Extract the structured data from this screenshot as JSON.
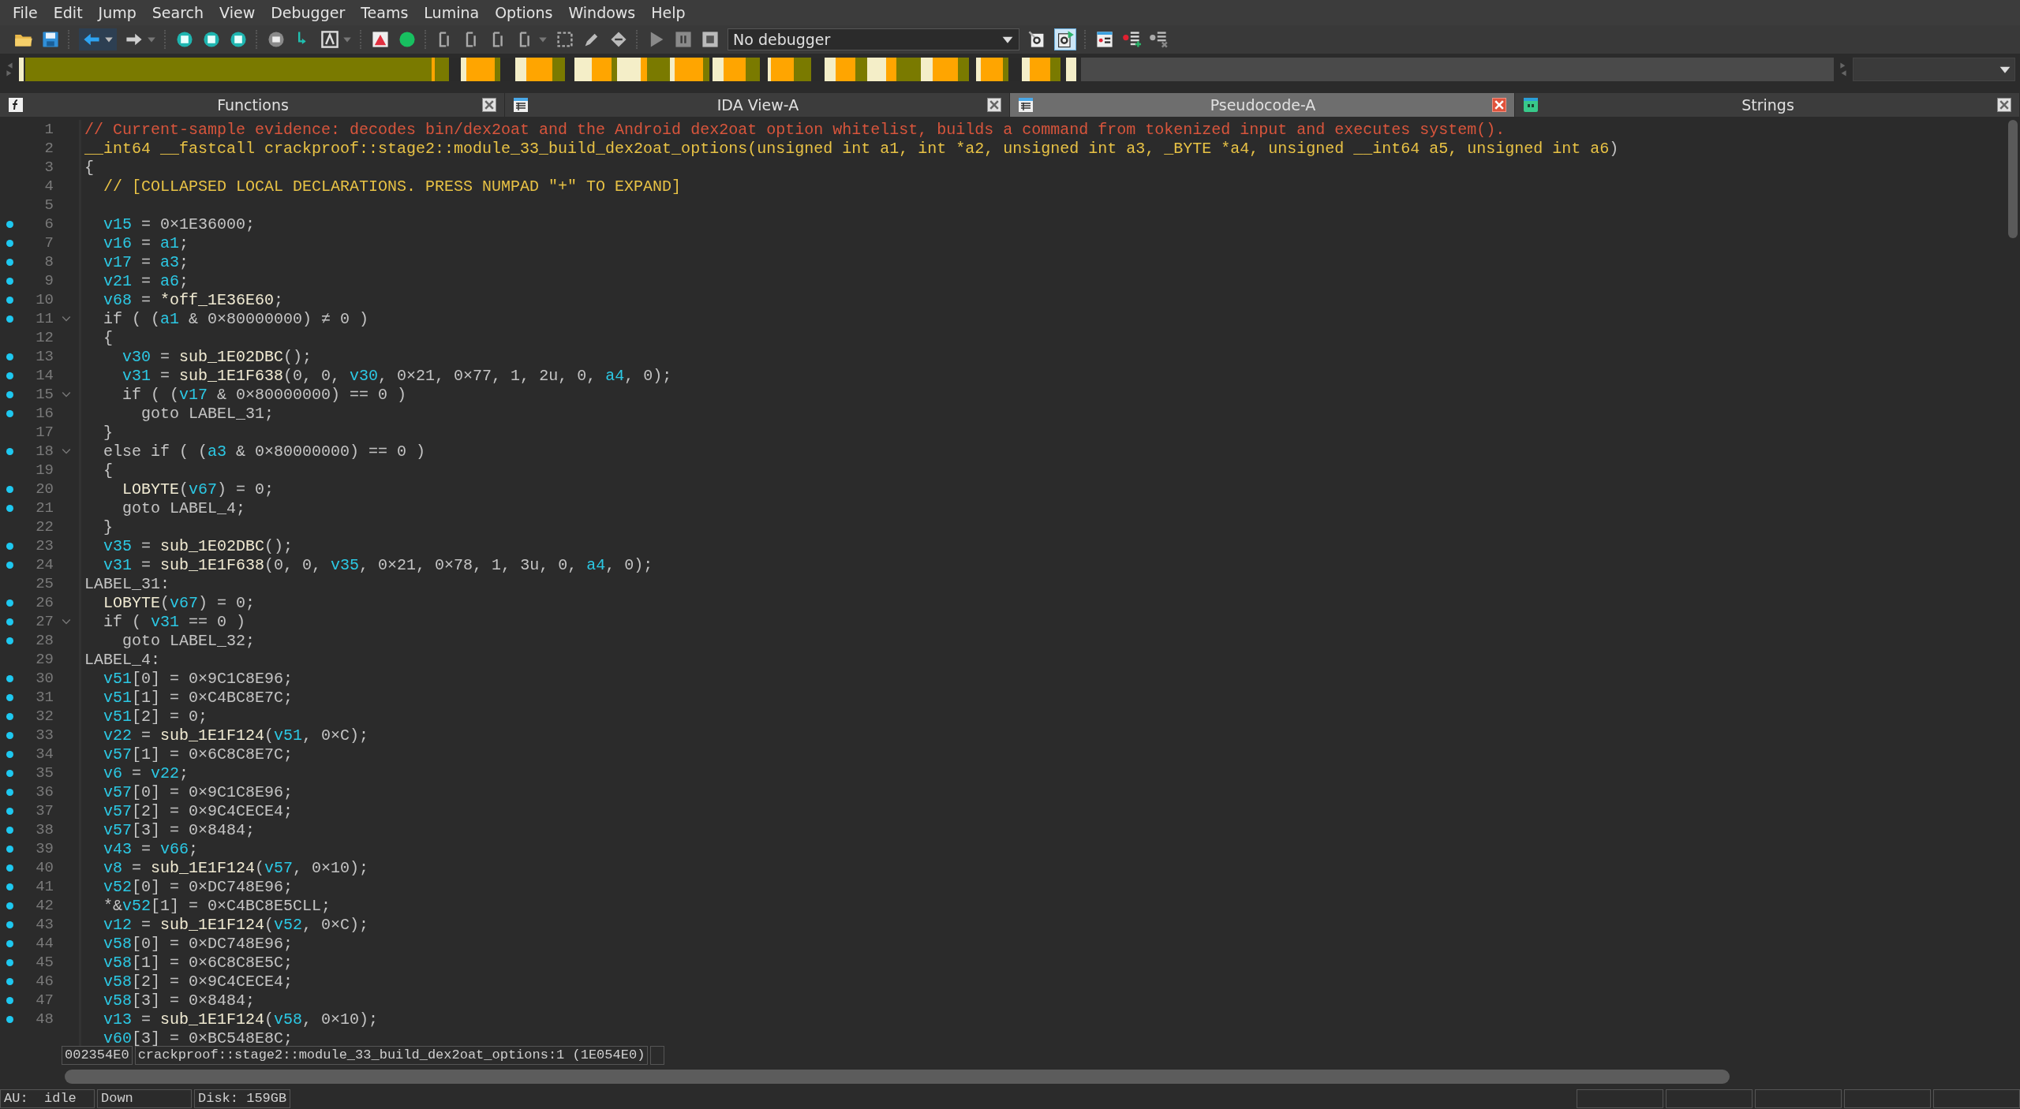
{
  "menu": [
    "File",
    "Edit",
    "Jump",
    "Search",
    "View",
    "Debugger",
    "Teams",
    "Lumina",
    "Options",
    "Windows",
    "Help"
  ],
  "toolbar": {
    "debugger_select": "No debugger"
  },
  "tabs": [
    {
      "label": "Functions",
      "selected": false,
      "kind": "functions"
    },
    {
      "label": "IDA View-A",
      "selected": false,
      "kind": "listing"
    },
    {
      "label": "Pseudocode-A",
      "selected": true,
      "kind": "listing"
    },
    {
      "label": "Strings",
      "selected": false,
      "kind": "strings"
    }
  ],
  "code": {
    "lines": [
      {
        "number": "1",
        "marked": false,
        "fold": false,
        "tokens": [
          {
            "kind": "comment",
            "text": "// Current-sample evidence: decodes bin/dex2oat and the Android dex2oat option whitelist, builds a command from tokenized input and executes system()."
          }
        ]
      },
      {
        "number": "2",
        "marked": false,
        "fold": false,
        "tokens": [
          {
            "kind": "header",
            "text": "__int64 __fastcall crackproof::stage2::module_33_build_dex2oat_options(unsigned int a1, int *a2, unsigned int a3, _BYTE *a4, unsigned __int64 a5, unsigned int a6"
          },
          {
            "kind": "plain",
            "text": ")"
          }
        ]
      },
      {
        "number": "3",
        "marked": false,
        "fold": false,
        "tokens": [
          {
            "kind": "plain",
            "text": "{"
          }
        ]
      },
      {
        "number": "4",
        "marked": false,
        "fold": false,
        "tokens": [
          {
            "kind": "header",
            "text": "  // [COLLAPSED LOCAL DECLARATIONS. PRESS NUMPAD \"+\" TO EXPAND]"
          }
        ]
      },
      {
        "number": "5",
        "marked": false,
        "fold": false
      },
      {
        "number": "6",
        "marked": true,
        "fold": false,
        "tokens": [
          {
            "kind": "var",
            "text": "  v15"
          },
          {
            "kind": "plain",
            "text": " = 0×1E36000;"
          }
        ]
      },
      {
        "number": "7",
        "marked": true,
        "fold": false,
        "tokens": [
          {
            "kind": "var",
            "text": "  v16"
          },
          {
            "kind": "plain",
            "text": " = "
          },
          {
            "kind": "var",
            "text": "a1"
          },
          {
            "kind": "plain",
            "text": ";"
          }
        ]
      },
      {
        "number": "8",
        "marked": true,
        "fold": false,
        "tokens": [
          {
            "kind": "var",
            "text": "  v17"
          },
          {
            "kind": "plain",
            "text": " = "
          },
          {
            "kind": "var",
            "text": "a3"
          },
          {
            "kind": "plain",
            "text": ";"
          }
        ]
      },
      {
        "number": "9",
        "marked": true,
        "fold": false,
        "tokens": [
          {
            "kind": "var",
            "text": "  v21"
          },
          {
            "kind": "plain",
            "text": " = "
          },
          {
            "kind": "var",
            "text": "a6"
          },
          {
            "kind": "plain",
            "text": ";"
          }
        ]
      },
      {
        "number": "10",
        "marked": true,
        "fold": false,
        "tokens": [
          {
            "kind": "var",
            "text": "  v68"
          },
          {
            "kind": "plain",
            "text": " = "
          },
          {
            "kind": "name",
            "text": "*off_1E36E60"
          },
          {
            "kind": "plain",
            "text": ";"
          }
        ]
      },
      {
        "number": "11",
        "marked": true,
        "fold": true,
        "tokens": [
          {
            "kind": "plain",
            "text": "  if ( ("
          },
          {
            "kind": "var",
            "text": "a1"
          },
          {
            "kind": "plain",
            "text": " & 0×80000000) ≠ 0 )"
          }
        ]
      },
      {
        "number": "12",
        "marked": false,
        "fold": false,
        "tokens": [
          {
            "kind": "plain",
            "text": "  {"
          }
        ]
      },
      {
        "number": "13",
        "marked": true,
        "fold": false,
        "tokens": [
          {
            "kind": "var",
            "text": "    v30"
          },
          {
            "kind": "plain",
            "text": " = "
          },
          {
            "kind": "name",
            "text": "sub_1E02DBC"
          },
          {
            "kind": "plain",
            "text": "();"
          }
        ]
      },
      {
        "number": "14",
        "marked": true,
        "fold": false,
        "tokens": [
          {
            "kind": "var",
            "text": "    v31"
          },
          {
            "kind": "plain",
            "text": " = "
          },
          {
            "kind": "name",
            "text": "sub_1E1F638"
          },
          {
            "kind": "plain",
            "text": "(0, 0, "
          },
          {
            "kind": "var",
            "text": "v30"
          },
          {
            "kind": "plain",
            "text": ", 0×21, 0×77, 1, 2u, 0, "
          },
          {
            "kind": "var",
            "text": "a4"
          },
          {
            "kind": "plain",
            "text": ", 0);"
          }
        ]
      },
      {
        "number": "15",
        "marked": true,
        "fold": true,
        "tokens": [
          {
            "kind": "plain",
            "text": "    if ( ("
          },
          {
            "kind": "var",
            "text": "v17"
          },
          {
            "kind": "plain",
            "text": " & 0×80000000) == 0 )"
          }
        ]
      },
      {
        "number": "16",
        "marked": true,
        "fold": false,
        "tokens": [
          {
            "kind": "plain",
            "text": "      goto LABEL_31;"
          }
        ]
      },
      {
        "number": "17",
        "marked": false,
        "fold": false,
        "tokens": [
          {
            "kind": "plain",
            "text": "  }"
          }
        ]
      },
      {
        "number": "18",
        "marked": true,
        "fold": true,
        "tokens": [
          {
            "kind": "plain",
            "text": "  else if ( ("
          },
          {
            "kind": "var",
            "text": "a3"
          },
          {
            "kind": "plain",
            "text": " & 0×80000000) == 0 )"
          }
        ]
      },
      {
        "number": "19",
        "marked": false,
        "fold": false,
        "tokens": [
          {
            "kind": "plain",
            "text": "  {"
          }
        ]
      },
      {
        "number": "20",
        "marked": true,
        "fold": false,
        "tokens": [
          {
            "kind": "name",
            "text": "    LOBYTE"
          },
          {
            "kind": "plain",
            "text": "("
          },
          {
            "kind": "var",
            "text": "v67"
          },
          {
            "kind": "plain",
            "text": ") = 0;"
          }
        ]
      },
      {
        "number": "21",
        "marked": true,
        "fold": false,
        "tokens": [
          {
            "kind": "plain",
            "text": "    goto LABEL_4;"
          }
        ]
      },
      {
        "number": "22",
        "marked": false,
        "fold": false,
        "tokens": [
          {
            "kind": "plain",
            "text": "  }"
          }
        ]
      },
      {
        "number": "23",
        "marked": true,
        "fold": false,
        "tokens": [
          {
            "kind": "var",
            "text": "  v35"
          },
          {
            "kind": "plain",
            "text": " = "
          },
          {
            "kind": "name",
            "text": "sub_1E02DBC"
          },
          {
            "kind": "plain",
            "text": "();"
          }
        ]
      },
      {
        "number": "24",
        "marked": true,
        "fold": false,
        "tokens": [
          {
            "kind": "var",
            "text": "  v31"
          },
          {
            "kind": "plain",
            "text": " = "
          },
          {
            "kind": "name",
            "text": "sub_1E1F638"
          },
          {
            "kind": "plain",
            "text": "(0, 0, "
          },
          {
            "kind": "var",
            "text": "v35"
          },
          {
            "kind": "plain",
            "text": ", 0×21, 0×78, 1, 3u, 0, "
          },
          {
            "kind": "var",
            "text": "a4"
          },
          {
            "kind": "plain",
            "text": ", 0);"
          }
        ]
      },
      {
        "number": "25",
        "marked": false,
        "fold": false,
        "tokens": [
          {
            "kind": "plain",
            "text": "LABEL_31:"
          }
        ]
      },
      {
        "number": "26",
        "marked": true,
        "fold": false,
        "tokens": [
          {
            "kind": "name",
            "text": "  LOBYTE"
          },
          {
            "kind": "plain",
            "text": "("
          },
          {
            "kind": "var",
            "text": "v67"
          },
          {
            "kind": "plain",
            "text": ") = 0;"
          }
        ]
      },
      {
        "number": "27",
        "marked": true,
        "fold": true,
        "tokens": [
          {
            "kind": "plain",
            "text": "  if ( "
          },
          {
            "kind": "var",
            "text": "v31"
          },
          {
            "kind": "plain",
            "text": " == 0 )"
          }
        ]
      },
      {
        "number": "28",
        "marked": true,
        "fold": false,
        "tokens": [
          {
            "kind": "plain",
            "text": "    goto LABEL_32;"
          }
        ]
      },
      {
        "number": "29",
        "marked": false,
        "fold": false,
        "tokens": [
          {
            "kind": "plain",
            "text": "LABEL_4:"
          }
        ]
      },
      {
        "number": "30",
        "marked": true,
        "fold": false,
        "tokens": [
          {
            "kind": "var",
            "text": "  v51"
          },
          {
            "kind": "plain",
            "text": "[0] = 0×9C1C8E96;"
          }
        ]
      },
      {
        "number": "31",
        "marked": true,
        "fold": false,
        "tokens": [
          {
            "kind": "var",
            "text": "  v51"
          },
          {
            "kind": "plain",
            "text": "[1] = 0×C4BC8E7C;"
          }
        ]
      },
      {
        "number": "32",
        "marked": true,
        "fold": false,
        "tokens": [
          {
            "kind": "var",
            "text": "  v51"
          },
          {
            "kind": "plain",
            "text": "[2] = 0;"
          }
        ]
      },
      {
        "number": "33",
        "marked": true,
        "fold": false,
        "tokens": [
          {
            "kind": "var",
            "text": "  v22"
          },
          {
            "kind": "plain",
            "text": " = "
          },
          {
            "kind": "name",
            "text": "sub_1E1F124"
          },
          {
            "kind": "plain",
            "text": "("
          },
          {
            "kind": "var",
            "text": "v51"
          },
          {
            "kind": "plain",
            "text": ", 0×C);"
          }
        ]
      },
      {
        "number": "34",
        "marked": true,
        "fold": false,
        "tokens": [
          {
            "kind": "var",
            "text": "  v57"
          },
          {
            "kind": "plain",
            "text": "[1] = 0×6C8C8E7C;"
          }
        ]
      },
      {
        "number": "35",
        "marked": true,
        "fold": false,
        "tokens": [
          {
            "kind": "var",
            "text": "  v6"
          },
          {
            "kind": "plain",
            "text": " = "
          },
          {
            "kind": "var",
            "text": "v22"
          },
          {
            "kind": "plain",
            "text": ";"
          }
        ]
      },
      {
        "number": "36",
        "marked": true,
        "fold": false,
        "tokens": [
          {
            "kind": "var",
            "text": "  v57"
          },
          {
            "kind": "plain",
            "text": "[0] = 0×9C1C8E96;"
          }
        ]
      },
      {
        "number": "37",
        "marked": true,
        "fold": false,
        "tokens": [
          {
            "kind": "var",
            "text": "  v57"
          },
          {
            "kind": "plain",
            "text": "[2] = 0×9C4CECE4;"
          }
        ]
      },
      {
        "number": "38",
        "marked": true,
        "fold": false,
        "tokens": [
          {
            "kind": "var",
            "text": "  v57"
          },
          {
            "kind": "plain",
            "text": "[3] = 0×8484;"
          }
        ]
      },
      {
        "number": "39",
        "marked": true,
        "fold": false,
        "tokens": [
          {
            "kind": "var",
            "text": "  v43"
          },
          {
            "kind": "plain",
            "text": " = "
          },
          {
            "kind": "var",
            "text": "v66"
          },
          {
            "kind": "plain",
            "text": ";"
          }
        ]
      },
      {
        "number": "40",
        "marked": true,
        "fold": false,
        "tokens": [
          {
            "kind": "var",
            "text": "  v8"
          },
          {
            "kind": "plain",
            "text": " = "
          },
          {
            "kind": "name",
            "text": "sub_1E1F124"
          },
          {
            "kind": "plain",
            "text": "("
          },
          {
            "kind": "var",
            "text": "v57"
          },
          {
            "kind": "plain",
            "text": ", 0×10);"
          }
        ]
      },
      {
        "number": "41",
        "marked": true,
        "fold": false,
        "tokens": [
          {
            "kind": "var",
            "text": "  v52"
          },
          {
            "kind": "plain",
            "text": "[0] = 0×DC748E96;"
          }
        ]
      },
      {
        "number": "42",
        "marked": true,
        "fold": false,
        "tokens": [
          {
            "kind": "plain",
            "text": "  *&"
          },
          {
            "kind": "var",
            "text": "v52"
          },
          {
            "kind": "plain",
            "text": "[1] = 0×C4BC8E5CLL;"
          }
        ]
      },
      {
        "number": "43",
        "marked": true,
        "fold": false,
        "tokens": [
          {
            "kind": "var",
            "text": "  v12"
          },
          {
            "kind": "plain",
            "text": " = "
          },
          {
            "kind": "name",
            "text": "sub_1E1F124"
          },
          {
            "kind": "plain",
            "text": "("
          },
          {
            "kind": "var",
            "text": "v52"
          },
          {
            "kind": "plain",
            "text": ", 0×C);"
          }
        ]
      },
      {
        "number": "44",
        "marked": true,
        "fold": false,
        "tokens": [
          {
            "kind": "var",
            "text": "  v58"
          },
          {
            "kind": "plain",
            "text": "[0] = 0×DC748E96;"
          }
        ]
      },
      {
        "number": "45",
        "marked": true,
        "fold": false,
        "tokens": [
          {
            "kind": "var",
            "text": "  v58"
          },
          {
            "kind": "plain",
            "text": "[1] = 0×6C8C8E5C;"
          }
        ]
      },
      {
        "number": "46",
        "marked": true,
        "fold": false,
        "tokens": [
          {
            "kind": "var",
            "text": "  v58"
          },
          {
            "kind": "plain",
            "text": "[2] = 0×9C4CECE4;"
          }
        ]
      },
      {
        "number": "47",
        "marked": true,
        "fold": false,
        "tokens": [
          {
            "kind": "var",
            "text": "  v58"
          },
          {
            "kind": "plain",
            "text": "[3] = 0×8484;"
          }
        ]
      },
      {
        "number": "48",
        "marked": true,
        "fold": false,
        "tokens": [
          {
            "kind": "var",
            "text": "  v13"
          },
          {
            "kind": "plain",
            "text": " = "
          },
          {
            "kind": "name",
            "text": "sub_1E1F124"
          },
          {
            "kind": "plain",
            "text": "("
          },
          {
            "kind": "var",
            "text": "v58"
          },
          {
            "kind": "plain",
            "text": ", 0×10);"
          }
        ]
      },
      {
        "marked": false,
        "fold": false,
        "tokens": [
          {
            "kind": "var",
            "text": "  v60"
          },
          {
            "kind": "plain",
            "text": "[3] = 0×BC548E8C;"
          }
        ]
      }
    ]
  },
  "location_bar": {
    "address": "002354E0",
    "location": "crackproof::stage2::module_33_build_dex2oat_options:1 (1E054E0)"
  },
  "status_bar": [
    "AU:  idle",
    "Down",
    "Disk: 159GB"
  ]
}
